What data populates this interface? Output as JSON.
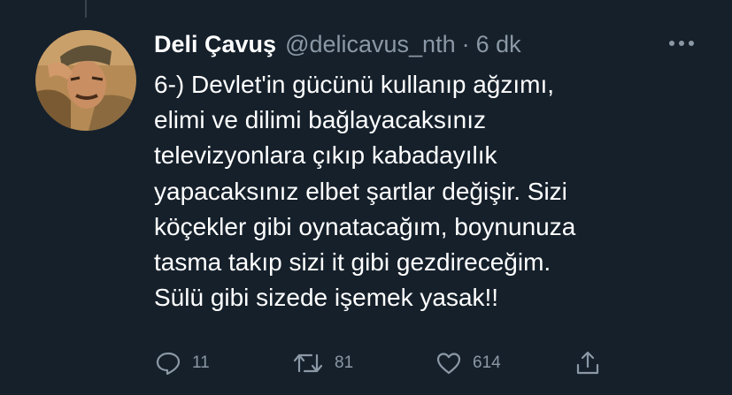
{
  "tweet": {
    "display_name": "Deli Çavuş",
    "handle": "@delicavus_nth",
    "separator": "·",
    "time": "6 dk",
    "text_lines": [
      "6-) Devlet'in gücünü kullanıp ağzımı,",
      "elimi ve dilimi bağlayacaksınız",
      "televizyonlara çıkıp kabadayılık",
      "yapacaksınız elbet şartlar değişir. Sizi",
      "köçekler gibi oynatacağım, boynunuza",
      "tasma takıp sizi it gibi gezdireceğim.",
      "Sülü gibi sizede işemek yasak!!"
    ]
  },
  "actions": {
    "replies": "11",
    "retweets": "81",
    "likes": "614"
  },
  "icons": {
    "reply": "reply-icon",
    "retweet": "retweet-icon",
    "like": "heart-icon",
    "share": "share-icon",
    "more": "more-icon"
  },
  "colors": {
    "background": "#15202b",
    "text": "#ffffff",
    "secondary": "#8b98a5",
    "thread_line": "#38444d"
  }
}
